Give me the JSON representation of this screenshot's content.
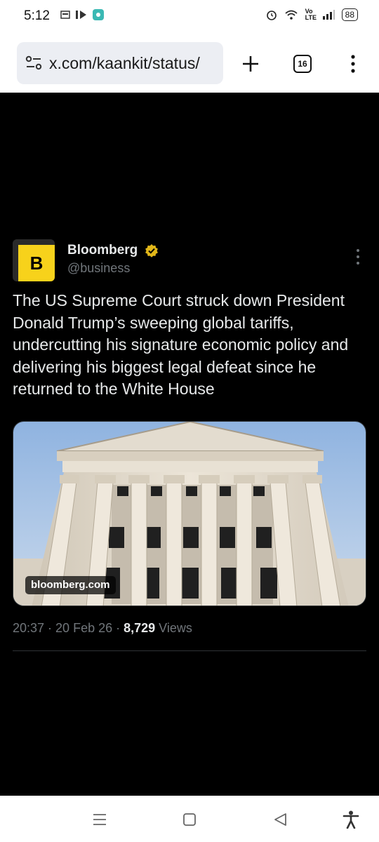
{
  "status_bar": {
    "time": "5:12",
    "network_label": "Vo LTE",
    "battery": "88"
  },
  "browser": {
    "url": "x.com/kaankit/status/",
    "tab_count": "16"
  },
  "tweet": {
    "author_name": "Bloomberg",
    "handle": "@business",
    "avatar_letter": "B",
    "text": "The US Supreme Court struck down President Donald Trump’s sweeping global tariffs, undercutting his signature economic policy and delivering his biggest legal defeat since he returned to the White House",
    "media_source": "bloomberg.com",
    "time": "20:37",
    "date": "20 Feb 26",
    "views_count": "8,729",
    "views_label": "Views"
  },
  "colors": {
    "verified_badge": "#e2b719",
    "avatar_bg": "#f7d21b",
    "text_primary": "#e7e9ea",
    "text_secondary": "#71767b"
  },
  "icons": {
    "site_settings": "tune-icon",
    "new_tab": "plus-icon",
    "menu": "vertical-dots-icon",
    "nav_recents": "menu-lines-icon",
    "nav_home": "square-icon",
    "nav_back": "triangle-back-icon",
    "accessibility": "accessibility-icon"
  }
}
